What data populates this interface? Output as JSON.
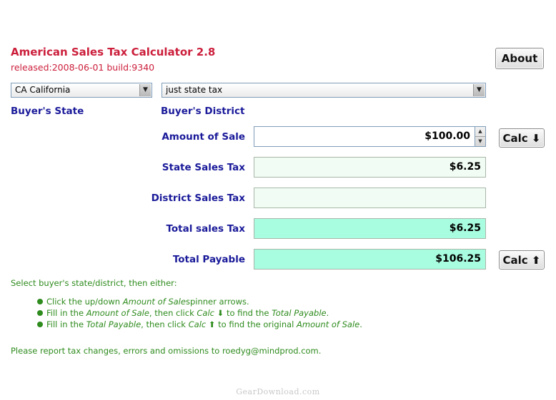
{
  "app": {
    "title": "American Sales Tax Calculator 2.8",
    "subtitle": "released:2008-06-01 build:9340",
    "about_label": "About"
  },
  "selectors": {
    "state_value": "CA California",
    "district_value": "just state tax",
    "state_label": "Buyer's State",
    "district_label": "Buyer's District"
  },
  "fields": {
    "amount_label": "Amount of Sale",
    "amount_value": "$100.00",
    "state_tax_label": "State Sales Tax",
    "state_tax_value": "$6.25",
    "district_tax_label": "District Sales Tax",
    "district_tax_value": "",
    "total_tax_label": "Total sales Tax",
    "total_tax_value": "$6.25",
    "total_payable_label": "Total Payable",
    "total_payable_value": "$106.25"
  },
  "buttons": {
    "calc_down": "Calc ⬇",
    "calc_up": "Calc ⬆"
  },
  "instructions": {
    "heading": "Select buyer's state/district, then either:",
    "bullet1_pre": "Click the up/down ",
    "bullet1_em": "Amount of Sale",
    "bullet1_post": " spinner arrows.",
    "bullet2_pre": "Fill in the ",
    "bullet2_em1": "Amount of Sale",
    "bullet2_mid": ", then click ",
    "bullet2_em2": "Calc ⬇",
    "bullet2_mid2": " to find the ",
    "bullet2_em3": "Total Payable",
    "bullet2_post": ".",
    "bullet3_pre": "Fill in the ",
    "bullet3_em1": "Total Payable",
    "bullet3_mid": ", then click ",
    "bullet3_em2": "Calc ⬆",
    "bullet3_mid2": " to find the original ",
    "bullet3_em3": "Amount of Sale",
    "bullet3_post": ".",
    "report": "Please report tax changes, errors and omissions to roedyg@mindprod.com."
  },
  "watermark": "GearDownload.com",
  "colors": {
    "title": "#cc1f3c",
    "label": "#1a1a9a",
    "instruction": "#2e8b1d",
    "result_field": "#a8fde0",
    "tax_field": "#f1fdf4"
  }
}
